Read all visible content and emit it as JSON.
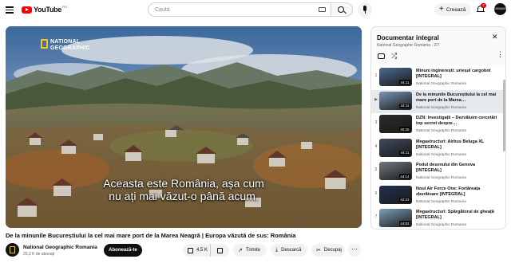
{
  "header": {
    "logo_text": "YouTube",
    "logo_country": "RO",
    "search_placeholder": "Caută",
    "create_label": "Creează",
    "notification_count": "2",
    "avatar_text": "1900ANOS"
  },
  "player": {
    "watermark": [
      "NATIONAL",
      "GEOGRAPHIC"
    ],
    "subtitle_line1": "Aceasta este România, așa cum",
    "subtitle_line2": "nu ați mai văzut-o până acum."
  },
  "video": {
    "title": "De la minunile Bucureștiului la cel mai mare port de la Marea Neagră | Europa văzută de sus: România",
    "channel_name": "National Geographic Romania",
    "subscribers": "20,2 K de abonați",
    "subscribe_label": "Abonează-te",
    "like_count": "4,5 K",
    "share_label": "Trimite",
    "download_label": "Descarcă",
    "clip_label": "Decupaj"
  },
  "playlist": {
    "title": "Documentar integral",
    "meta": "National Geographic Romania - 2/7",
    "items": [
      {
        "index": "1",
        "title": "Minuni inginerești: urieșul cargobot [INTEGRAL]",
        "channel": "National Geographic Romania",
        "duration": "44:11",
        "active": false,
        "thumb_color": "#4b6a8e"
      },
      {
        "index": "▶",
        "title": "De la minunile Bucureștiului la cel mai mare port de la Marea…",
        "channel": "National Geographic Romania",
        "duration": "44:11",
        "active": true,
        "thumb_color": "#7a96b5"
      },
      {
        "index": "3",
        "title": "DZN: Investigații – Dezvăluim cercetări top secret despre…",
        "channel": "National Geographic Romania",
        "duration": "40:25",
        "active": false,
        "thumb_color": "#2b2b2b"
      },
      {
        "index": "4",
        "title": "Megastructuri: Airbus Beluga XL [INTEGRAL]",
        "channel": "National Geographic Romania",
        "duration": "44:11",
        "active": false,
        "thumb_color": "#3f4c5e"
      },
      {
        "index": "5",
        "title": "Podul desenului din Genova [INTEGRAL]",
        "channel": "National Geographic Romania",
        "duration": "44:14",
        "active": false,
        "thumb_color": "#6f7a80"
      },
      {
        "index": "6",
        "title": "Noul Air Force One: Fortăreața zburătoare [INTEGRAL]",
        "channel": "National Geographic Romania",
        "duration": "42:23",
        "active": false,
        "thumb_color": "#20324f"
      },
      {
        "index": "7",
        "title": "Megastructuri: Spărgătorul de gheață [INTEGRAL]",
        "channel": "National Geographic Romania",
        "duration": "44:02",
        "active": false,
        "thumb_color": "#7fa0b8"
      }
    ]
  }
}
